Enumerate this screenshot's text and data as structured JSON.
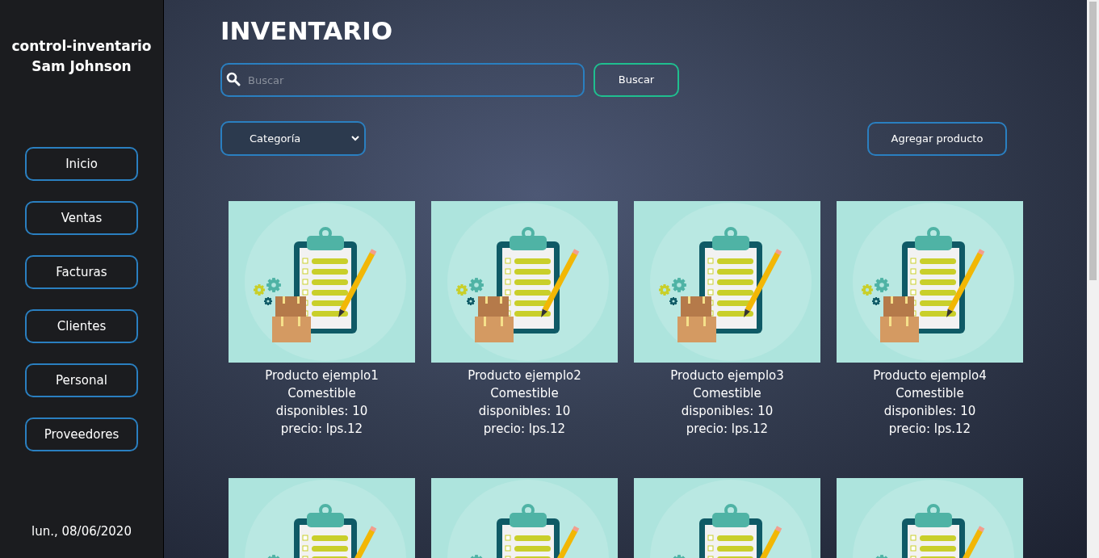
{
  "sidebar": {
    "app_name": "control-inventario",
    "user": "Sam Johnson",
    "items": [
      {
        "label": "Inicio"
      },
      {
        "label": "Ventas"
      },
      {
        "label": "Facturas"
      },
      {
        "label": "Clientes"
      },
      {
        "label": "Personal"
      },
      {
        "label": "Proveedores"
      }
    ],
    "date": "lun., 08/06/2020"
  },
  "title": "INVENTARIO",
  "search": {
    "placeholder": "Buscar",
    "button": "Buscar"
  },
  "category_select": {
    "value": "Categoría"
  },
  "add_button": "Agregar producto",
  "products": [
    {
      "kind": "card",
      "name": "Producto ejemplo1",
      "category": "Comestible",
      "stock": "disponibles: 10",
      "price": "precio: lps.12"
    },
    {
      "kind": "card",
      "name": "Producto ejemplo2",
      "category": "Comestible",
      "stock": "disponibles: 10",
      "price": "precio: lps.12"
    },
    {
      "kind": "card",
      "name": "Producto ejemplo3",
      "category": "Comestible",
      "stock": "disponibles: 10",
      "price": "precio: lps.12"
    },
    {
      "kind": "card",
      "name": "Producto ejemplo4",
      "category": "Comestible",
      "stock": "disponibles: 10",
      "price": "precio: lps.12"
    },
    {
      "kind": "image_only"
    },
    {
      "kind": "image_only"
    },
    {
      "kind": "image_only"
    },
    {
      "kind": "image_only"
    }
  ]
}
